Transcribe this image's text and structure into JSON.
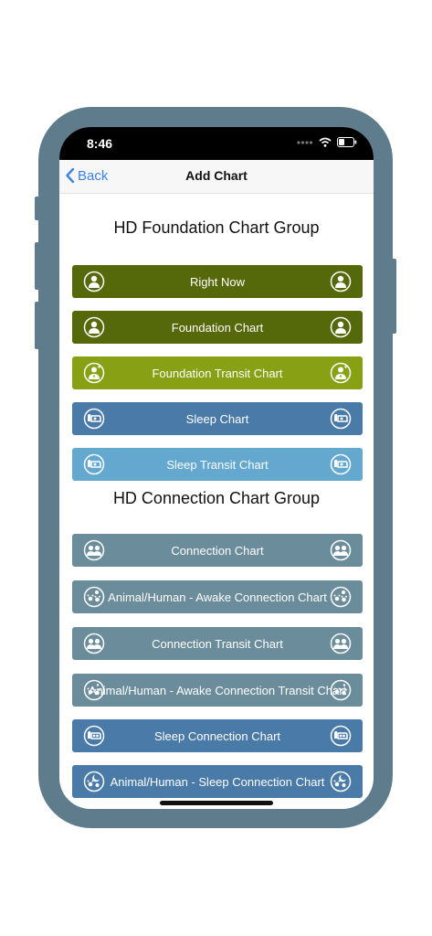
{
  "status_bar": {
    "time": "8:46"
  },
  "nav": {
    "back_label": "Back",
    "title": "Add Chart"
  },
  "colors": {
    "olive": "#56690a",
    "lime": "#87a014",
    "blue": "#4a7aa8",
    "lightblue": "#64a8cf",
    "slate": "#6b8d9b",
    "frame": "#5f7c8c"
  },
  "groups": [
    {
      "title": "HD Foundation Chart Group",
      "buttons": [
        {
          "label": "Right Now",
          "icon": "person-icon"
        },
        {
          "label": "Foundation Chart",
          "icon": "person-icon"
        },
        {
          "label": "Foundation Transit Chart",
          "icon": "person-transit-icon"
        },
        {
          "label": "Sleep Chart",
          "icon": "sleep-icon"
        },
        {
          "label": "Sleep Transit Chart",
          "icon": "sleep-icon"
        }
      ]
    },
    {
      "title": "HD Connection Chart Group",
      "buttons": [
        {
          "label": "Connection Chart",
          "icon": "two-people-icon"
        },
        {
          "label": "Animal/Human - Awake Connection Chart",
          "icon": "paw-sun-icon"
        },
        {
          "label": "Connection Transit Chart",
          "icon": "two-people-icon"
        },
        {
          "label": "Animal/Human - Awake Connection Transit Chart",
          "icon": "paw-transit-icon"
        },
        {
          "label": "Sleep Connection Chart",
          "icon": "sleep-connection-icon"
        },
        {
          "label": "Animal/Human - Sleep Connection Chart",
          "icon": "paw-moon-icon"
        }
      ]
    }
  ]
}
